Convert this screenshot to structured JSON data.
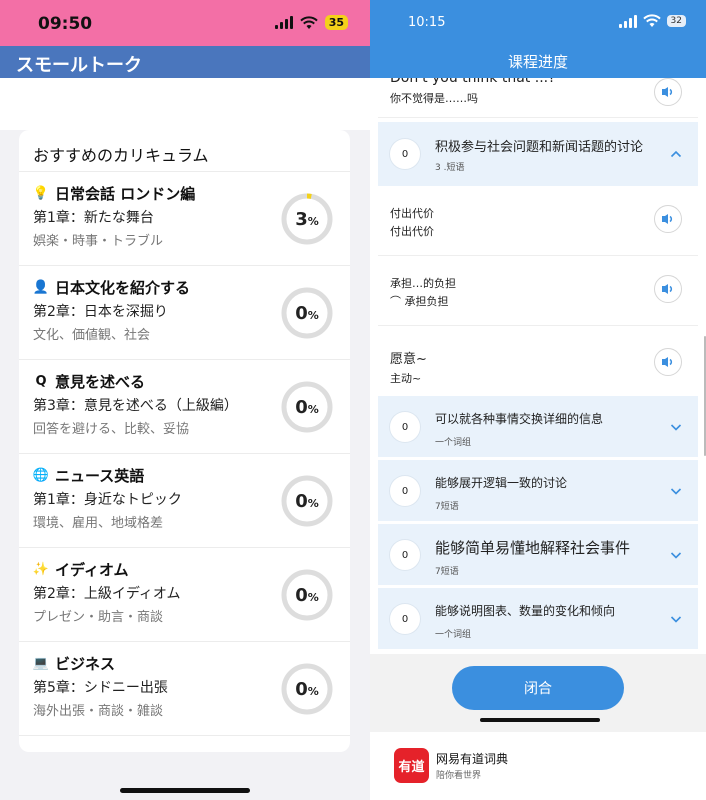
{
  "left": {
    "status": {
      "time": "09:50",
      "battery": "35"
    },
    "header_title": "スモールトーク",
    "card_title": "おすすめのカリキュラム",
    "courses": [
      {
        "icon": "lamp-icon",
        "glyph": "💡",
        "name": "日常会話 ロンドン編",
        "chapter": "第1章：新たな舞台",
        "tags": "娯楽・時事・トラブル",
        "progress_value": "3",
        "progress_unit": "%",
        "progress_fraction": 0.03
      },
      {
        "icon": "person-icon",
        "glyph": "👤",
        "name": "日本文化を紹介する",
        "chapter": "第2章：日本を深掘り",
        "tags": "文化、価値観、社会",
        "progress_value": "0",
        "progress_unit": "%",
        "progress_fraction": 0
      },
      {
        "icon": "opinion-icon",
        "glyph": "Q",
        "name": "意見を述べる",
        "chapter": "第3章：意見を述べる（上級編）",
        "tags": "回答を避ける、比較、妥協",
        "progress_value": "0",
        "progress_unit": "%",
        "progress_fraction": 0
      },
      {
        "icon": "globe-icon",
        "glyph": "🌐",
        "name": "ニュース英語",
        "chapter": "第1章：身近なトピック",
        "tags": "環境、雇用、地域格差",
        "progress_value": "0",
        "progress_unit": "%",
        "progress_fraction": 0
      },
      {
        "icon": "sparkle-icon",
        "glyph": "✨",
        "name": "イディオム",
        "chapter": "第2章：上級イディオム",
        "tags": "プレゼン・助言・商談",
        "progress_value": "0",
        "progress_unit": "%",
        "progress_fraction": 0
      },
      {
        "icon": "laptop-icon",
        "glyph": "💻",
        "name": "ビジネス",
        "chapter": "第5章：シドニー出張",
        "tags": "海外出張・商談・雑談",
        "progress_value": "0",
        "progress_unit": "%",
        "progress_fraction": 0
      }
    ],
    "colors": {
      "status_bar": "#f36fa6",
      "header": "#4a76bd",
      "ring_track": "#dddddd",
      "ring_progress": "#f3d11a"
    }
  },
  "right": {
    "status": {
      "time": "10:15",
      "battery": "32"
    },
    "page_title": "课程进度",
    "cut_item": {
      "en": "Don't you think that ...?",
      "zh": "你不觉得是……吗"
    },
    "expanded_group": {
      "count": "0",
      "title": "积极参与社会问题和新闻话题的讨论",
      "sub": "3 .短语"
    },
    "phrases": [
      {
        "line1": "付出代价",
        "line2": "付出代价"
      },
      {
        "line1": "承担…的负担",
        "line2": "⌒ 承担负担"
      },
      {
        "line1": "愿意~",
        "line2": "主动~"
      }
    ],
    "groups": [
      {
        "count": "0",
        "title": "可以就各种事情交换详细的信息",
        "sub": "一个词组"
      },
      {
        "count": "0",
        "title": "能够展开逻辑一致的讨论",
        "sub": "7短语"
      },
      {
        "count": "0",
        "title": "能够简单易懂地解释社会事件",
        "sub": "7短语"
      },
      {
        "count": "0",
        "title": "能够说明图表、数量的变化和倾向",
        "sub": "一个词组"
      }
    ],
    "close_label": "闭合",
    "brand": {
      "logo_text": "有道",
      "name": "网易有道词典",
      "sub": "陪你看世界"
    },
    "colors": {
      "primary": "#3b8fdf",
      "group_bg": "#e9f2fb",
      "logo": "#e5222a"
    }
  }
}
